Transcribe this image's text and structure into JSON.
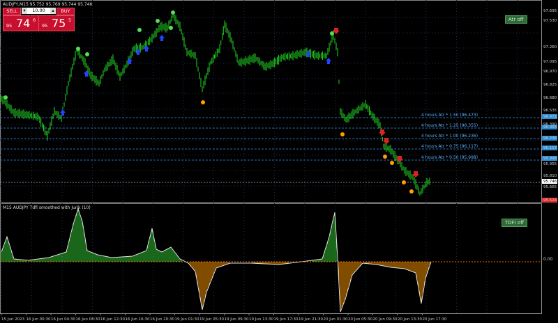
{
  "window": {
    "title": "AUDJPY,M15  95.752 95.769 95.744 95.746"
  },
  "trade_panel": {
    "sell_label": "SELL",
    "buy_label": "BUY",
    "lot_value": "10.00",
    "minus": "▾",
    "plus": "▴",
    "sell_quote": {
      "pre": "95",
      "big": "74",
      "sup": "6"
    },
    "buy_quote": {
      "pre": "95",
      "big": "75",
      "sup": "5"
    }
  },
  "main_chart": {
    "toggle_label": "Atr off",
    "price_axis": [
      "97.695",
      "97.530",
      "97.260",
      "97.095",
      "96.970",
      "96.825",
      "96.680",
      "96.535",
      "96.472",
      "96.390",
      "96.355",
      "96.236",
      "96.117",
      "95.998",
      "95.955",
      "95.810",
      "95.746",
      "95.665",
      "95.524"
    ],
    "levels": [
      {
        "label": "4 hours Atr * 1.50 (96.473)",
        "value": "96.473"
      },
      {
        "label": "4 hours Atr * 1.25 (96.355)",
        "value": "96.355"
      },
      {
        "label": "4 hours Atr * 1.00 (96.236)",
        "value": "96.236"
      },
      {
        "label": "4 hours Atr * 0.75 (96.117)",
        "value": "96.117"
      },
      {
        "label": "4 hours Atr * 0.50 (95.998)",
        "value": "95.998"
      }
    ],
    "current_price": "95.746",
    "bottom_price": "95.524"
  },
  "indicator": {
    "title": "M15 AUDJPY Tdfi smoothed with Jurik (10)",
    "toggle_label": "TDFI off",
    "zero_label": "0.00"
  },
  "time_axis": [
    "15 Jun 2023",
    "16 Jun 00:30",
    "16 Jun 04:30",
    "16 Jun 08:30",
    "16 Jun 12:30",
    "16 Jun 16:30",
    "16 Jun 20:30",
    "19 Jun 01:30",
    "19 Jun 05:30",
    "19 Jun 09:30",
    "19 Jun 13:30",
    "19 Jun 17:30",
    "19 Jun 21:30",
    "20 Jun 01:30",
    "20 Jun 05:30",
    "20 Jun 09:30",
    "20 Jun 13:30",
    "20 Jun 17:30"
  ],
  "colors": {
    "bull_candle": "#22dd22",
    "level_line": "#2a6fb5",
    "sell_arrow": "#dd2222",
    "buy_arrow": "#2244ff",
    "dot_orange": "#ffa000",
    "dot_green": "#55dd55",
    "hist_green": "#33cc33",
    "hist_orange": "#ff9900",
    "tdfi_line": "#e0e0e0"
  }
}
